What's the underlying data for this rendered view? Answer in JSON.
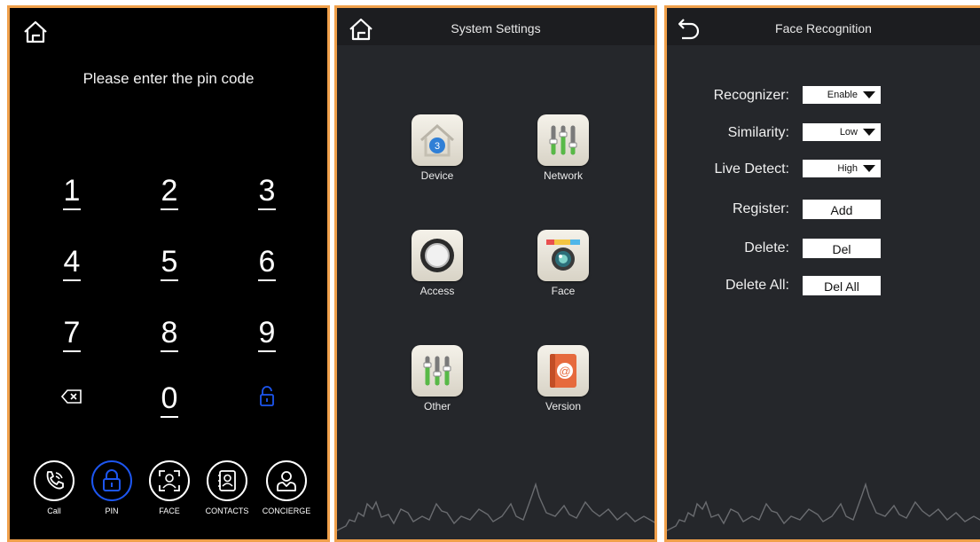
{
  "pin_panel": {
    "title": "Please enter the pin code",
    "keys": [
      "1",
      "2",
      "3",
      "4",
      "5",
      "6",
      "7",
      "8",
      "9",
      "0"
    ],
    "nav": [
      {
        "label": "Call",
        "icon": "phone-icon"
      },
      {
        "label": "PIN",
        "icon": "lock-icon"
      },
      {
        "label": "FACE",
        "icon": "face-scan-icon"
      },
      {
        "label": "CONTACTS",
        "icon": "contacts-icon"
      },
      {
        "label": "CONCIERGE",
        "icon": "concierge-icon"
      }
    ],
    "active_color": "#1d56f0"
  },
  "system_settings": {
    "title": "System Settings",
    "apps": [
      {
        "label": "Device",
        "icon": "house-icon",
        "badge": "3"
      },
      {
        "label": "Network",
        "icon": "sliders-icon"
      },
      {
        "label": "Access",
        "icon": "knob-icon"
      },
      {
        "label": "Face",
        "icon": "camera-icon"
      },
      {
        "label": "Other",
        "icon": "sliders-icon"
      },
      {
        "label": "Version",
        "icon": "address-book-icon"
      }
    ]
  },
  "face_recognition": {
    "title": "Face Recognition",
    "rows": [
      {
        "label": "Recognizer:",
        "value": "Enable"
      },
      {
        "label": "Similarity:",
        "value": "Low"
      },
      {
        "label": "Live Detect:",
        "value": "High"
      },
      {
        "label": "Register:",
        "value": "Add"
      },
      {
        "label": "Delete:",
        "value": "Del"
      },
      {
        "label": "Delete All:",
        "value": "Del All"
      }
    ]
  },
  "colors": {
    "panel_border": "#f0a04b",
    "panel_bg": "#25272b",
    "header_bg": "#1c1d20"
  }
}
